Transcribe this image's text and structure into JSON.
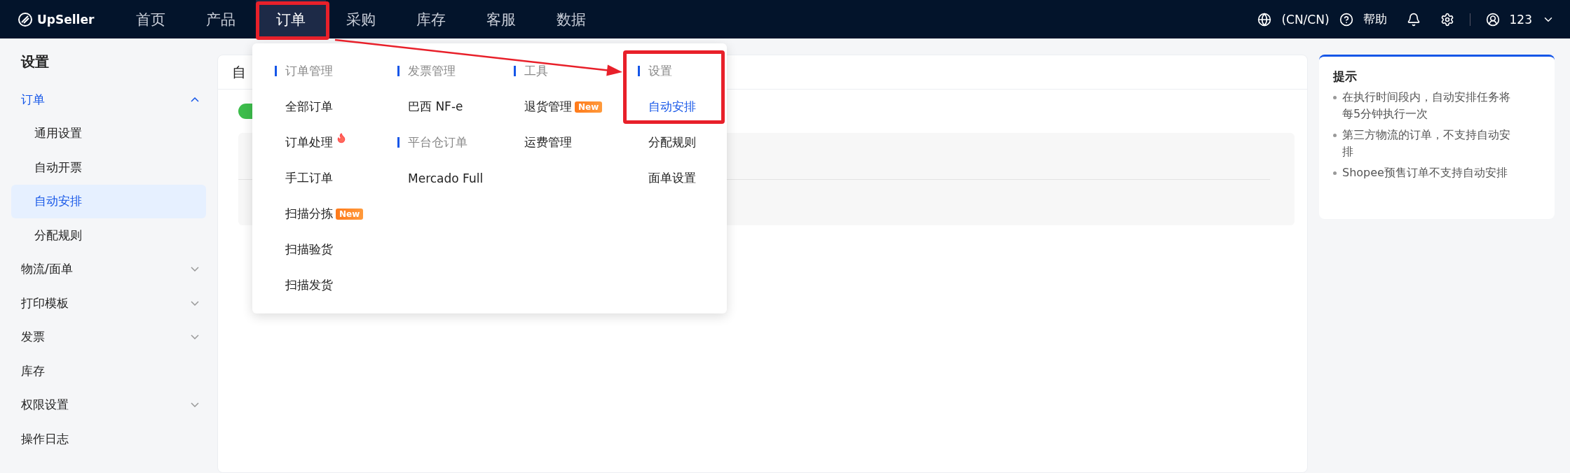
{
  "top_bar": {
    "logo": "UpSeller",
    "nav": [
      {
        "label": "首页",
        "selected": false
      },
      {
        "label": "产品",
        "selected": false
      },
      {
        "label": "订单",
        "selected": true
      },
      {
        "label": "采购",
        "selected": false
      },
      {
        "label": "库存",
        "selected": false
      },
      {
        "label": "客服",
        "selected": false
      },
      {
        "label": "数据",
        "selected": false
      }
    ],
    "language": "(CN/CN)",
    "help": "帮助",
    "user": "123"
  },
  "sidebar": {
    "title": "设置",
    "items": [
      {
        "label": "订单",
        "kind": "group",
        "expanded": true,
        "children": [
          {
            "label": "通用设置",
            "selected": false
          },
          {
            "label": "自动开票",
            "selected": false
          },
          {
            "label": "自动安排",
            "selected": true
          },
          {
            "label": "分配规则",
            "selected": false
          }
        ]
      },
      {
        "label": "物流/面单",
        "kind": "group",
        "expanded": false
      },
      {
        "label": "打印模板",
        "kind": "group",
        "expanded": false
      },
      {
        "label": "发票",
        "kind": "group",
        "expanded": false
      },
      {
        "label": "库存",
        "kind": "link"
      },
      {
        "label": "权限设置",
        "kind": "group",
        "expanded": false
      },
      {
        "label": "操作日志",
        "kind": "link"
      }
    ]
  },
  "main": {
    "title": "自",
    "toggle": {
      "on": true
    }
  },
  "dropdown": {
    "columns": [
      {
        "sections": [
          {
            "heading": "订单管理",
            "items": [
              {
                "label": "全部订单",
                "selected": false,
                "hot": false
              },
              {
                "label": "订单处理",
                "selected": false,
                "hot": true
              },
              {
                "label": "手工订单",
                "selected": false,
                "hot": false
              },
              {
                "label": "扫描分拣",
                "selected": false,
                "hot": false,
                "badge": "New"
              },
              {
                "label": "扫描验货",
                "selected": false,
                "hot": false
              },
              {
                "label": "扫描发货",
                "selected": false,
                "hot": false
              }
            ]
          }
        ]
      },
      {
        "sections": [
          {
            "heading": "发票管理",
            "items": [
              {
                "label": "巴西 NF-e",
                "selected": false,
                "hot": false
              }
            ]
          },
          {
            "heading": "平台仓订单",
            "items": [
              {
                "label": "Mercado Full",
                "selected": false,
                "hot": false
              }
            ]
          }
        ]
      },
      {
        "sections": [
          {
            "heading": "工具",
            "items": [
              {
                "label": "退货管理",
                "selected": false,
                "hot": false,
                "badge": "New"
              },
              {
                "label": "运费管理",
                "selected": false,
                "hot": false
              }
            ]
          }
        ]
      },
      {
        "sections": [
          {
            "heading": "设置",
            "items": [
              {
                "label": "自动安排",
                "selected": true,
                "hot": false
              },
              {
                "label": "分配规则",
                "selected": false,
                "hot": false
              },
              {
                "label": "面单设置",
                "selected": false,
                "hot": false
              }
            ]
          }
        ]
      }
    ]
  },
  "tips": {
    "title": "提示",
    "items": [
      "在执行时间段内，自动安排任务将每5分钟执行一次",
      "第三方物流的订单，不支持自动安排",
      "Shopee预售订单不支持自动安排"
    ]
  }
}
